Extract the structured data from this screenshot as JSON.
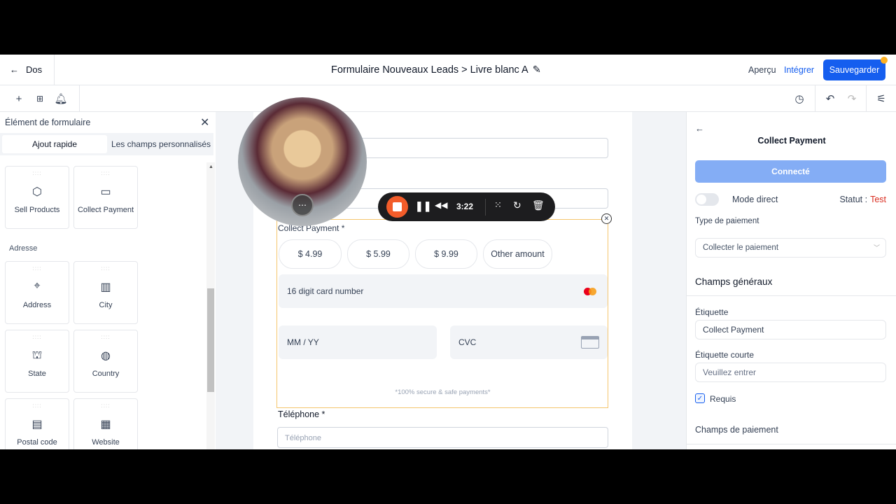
{
  "header": {
    "back_label": "Dos",
    "title": "Formulaire Nouveaux Leads > Livre blanc A",
    "preview": "Aperçu",
    "integrate": "Intégrer",
    "save": "Sauvegarder"
  },
  "left_panel": {
    "title": "Élément de formulaire",
    "tabs": [
      "Ajout rapide",
      "Les champs personnalisés"
    ],
    "section_address": "Adresse",
    "tiles": [
      {
        "label": "Sell Products",
        "icon": "box-icon"
      },
      {
        "label": "Collect Payment",
        "icon": "card-icon"
      },
      {
        "label": "Address",
        "icon": "map-pin-icon"
      },
      {
        "label": "City",
        "icon": "city-icon"
      },
      {
        "label": "State",
        "icon": "state-building-icon"
      },
      {
        "label": "Country",
        "icon": "globe-icon"
      },
      {
        "label": "Postal code",
        "icon": "postal-icon"
      },
      {
        "label": "Website",
        "icon": "website-icon"
      }
    ]
  },
  "form": {
    "collect_label": "Collect Payment *",
    "amounts": [
      "$  4.99",
      "$  5.99",
      "$  9.99",
      "Other amount"
    ],
    "card_placeholder": "16 digit card number",
    "expiry_placeholder": "MM / YY",
    "cvc_placeholder": "CVC",
    "secure_note": "*100% secure & safe payments*",
    "phone_label": "Téléphone *",
    "phone_placeholder": "Téléphone"
  },
  "recorder": {
    "time": "3:22"
  },
  "right_panel": {
    "title": "Collect Payment",
    "connected": "Connecté",
    "mode_direct": "Mode direct",
    "status_label": "Statut :",
    "status_value": "Test",
    "payment_type_label": "Type de paiement",
    "payment_type_value": "Collecter le paiement",
    "general_fields": "Champs généraux",
    "label_label": "Étiquette",
    "label_value": "Collect Payment",
    "short_label": "Étiquette courte",
    "short_placeholder": "Veuillez entrer",
    "required": "Requis",
    "required_checked": true,
    "payment_fields": "Champs de paiement"
  },
  "colors": {
    "primary": "#155eef",
    "connected": "#84adf5",
    "status_test": "#d92d20",
    "selected_border": "#f5c66e",
    "recorder_stop": "#f25c2a"
  }
}
